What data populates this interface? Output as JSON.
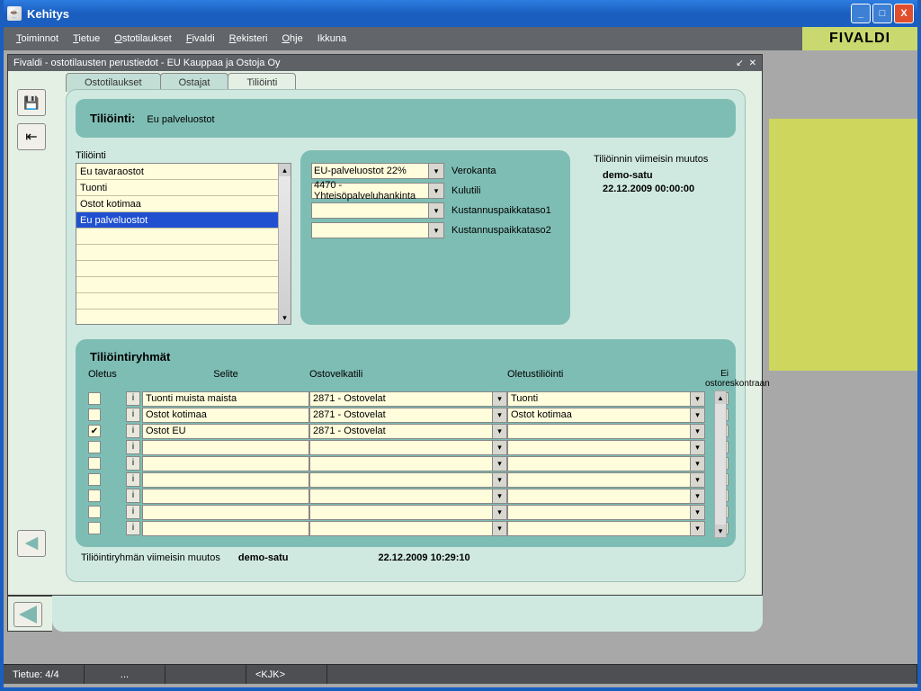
{
  "window": {
    "title": "Kehitys"
  },
  "menu": {
    "toiminnot": "Toiminnot",
    "tietue": "Tietue",
    "ostotilaukset": "Ostotilaukset",
    "fivaldi": "Fivaldi",
    "rekisteri": "Rekisteri",
    "ohje": "Ohje",
    "ikkuna": "Ikkuna"
  },
  "brand": "FIVALDI",
  "inner": {
    "title": "Fivaldi - ostotilausten perustiedot - EU Kauppaa ja Ostoja Oy",
    "tabs": {
      "t1": "Ostotilaukset",
      "t2": "Ostajat",
      "t3": "Tiliöinti"
    },
    "header_label": "Tiliöinti:",
    "header_value": "Eu palveluostot"
  },
  "tilointi": {
    "label": "Tiliöinti",
    "items": [
      "Eu tavaraostot",
      "Tuonti",
      "Ostot kotimaa",
      "Eu palveluostot"
    ],
    "selected_index": 3
  },
  "center": {
    "verokanta_label": "Verokanta",
    "verokanta_value": "EU-palveluostot 22%",
    "kulutili_label": "Kulutili",
    "kulutili_value": "4470 - Yhteisöpalveluhankinta",
    "kp1_label": "Kustannuspaikkataso1",
    "kp1_value": "",
    "kp2_label": "Kustannuspaikkataso2",
    "kp2_value": ""
  },
  "info": {
    "line1": "Tiliöinnin viimeisin muutos",
    "user": "demo-satu",
    "ts": "22.12.2009 00:00:00"
  },
  "groups": {
    "title": "Tiliöintiryhmät",
    "hdr_oletus": "Oletus",
    "hdr_selite": "Selite",
    "hdr_ostovelkatili": "Ostovelkatili",
    "hdr_oletustiliointi": "Oletustiliöinti",
    "hdr_ei": "Ei ostoreskontraan",
    "rows": [
      {
        "oletus": false,
        "selite": "Tuonti muista maista",
        "ostovelka": "2871 - Ostovelat",
        "olet": "Tuonti",
        "ei": false
      },
      {
        "oletus": false,
        "selite": "Ostot kotimaa",
        "ostovelka": "2871 - Ostovelat",
        "olet": "Ostot kotimaa",
        "ei": false
      },
      {
        "oletus": true,
        "selite": "Ostot EU",
        "ostovelka": "2871 - Ostovelat",
        "olet": "",
        "ei": true
      },
      {
        "oletus": false,
        "selite": "",
        "ostovelka": "",
        "olet": "",
        "ei": false
      },
      {
        "oletus": false,
        "selite": "",
        "ostovelka": "",
        "olet": "",
        "ei": false
      },
      {
        "oletus": false,
        "selite": "",
        "ostovelka": "",
        "olet": "",
        "ei": false
      },
      {
        "oletus": false,
        "selite": "",
        "ostovelka": "",
        "olet": "",
        "ei": false
      },
      {
        "oletus": false,
        "selite": "",
        "ostovelka": "",
        "olet": "",
        "ei": false
      },
      {
        "oletus": false,
        "selite": "",
        "ostovelka": "",
        "olet": "",
        "ei": false
      }
    ],
    "footer_label": "Tiliöintiryhmän viimeisin muutos",
    "footer_user": "demo-satu",
    "footer_ts": "22.12.2009 10:29:10"
  },
  "status": {
    "tietue": "Tietue: 4/4",
    "dots": "...",
    "user": "<KJK>"
  }
}
